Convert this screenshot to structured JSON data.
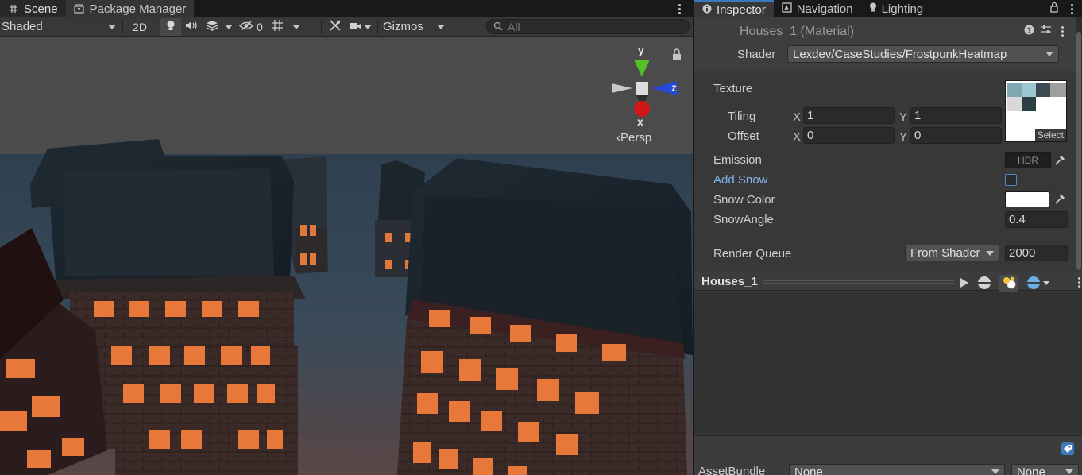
{
  "scene_tabs": [
    {
      "label": "Scene",
      "icon": "hash-icon"
    },
    {
      "label": "Package Manager",
      "icon": "package-icon"
    }
  ],
  "scene_toolbar": {
    "shading_mode": "Shaded",
    "toggle_2d": "2D",
    "hidden_count": "0",
    "gizmos_label": "Gizmos",
    "search_placeholder": "All"
  },
  "viewport": {
    "axis_y": "y",
    "axis_z": "z",
    "axis_x": "x",
    "projection": "‹Persp"
  },
  "inspector_tabs": [
    {
      "label": "Inspector",
      "icon": "info-icon"
    },
    {
      "label": "Navigation",
      "icon": "navigation-icon"
    },
    {
      "label": "Lighting",
      "icon": "lightbulb-icon"
    }
  ],
  "material": {
    "title": "Houses_1 (Material)",
    "shader_label": "Shader",
    "shader_value": "Lexdev/CaseStudies/FrostpunkHeatmap",
    "texture_label": "Texture",
    "texture_select": "Select",
    "tiling_label": "Tiling",
    "tiling_x_label": "X",
    "tiling_x": "1",
    "tiling_y_label": "Y",
    "tiling_y": "1",
    "offset_label": "Offset",
    "offset_x_label": "X",
    "offset_x": "0",
    "offset_y_label": "Y",
    "offset_y": "0",
    "emission_label": "Emission",
    "emission_hdr": "HDR",
    "add_snow_label": "Add Snow",
    "add_snow_checked": false,
    "snow_color_label": "Snow Color",
    "snow_color": "#ffffff",
    "snow_angle_label": "SnowAngle",
    "snow_angle": "0.4",
    "render_queue_label": "Render Queue",
    "render_queue_mode": "From Shader",
    "render_queue_value": "2000"
  },
  "preview": {
    "title": "Houses_1"
  },
  "asset_bundle": {
    "label": "AssetBundle",
    "name": "None",
    "variant": "None"
  },
  "colors": {
    "accent_blue": "#3a79bb",
    "label_blue": "#82b2f0",
    "window_glow": "#e8783a"
  }
}
